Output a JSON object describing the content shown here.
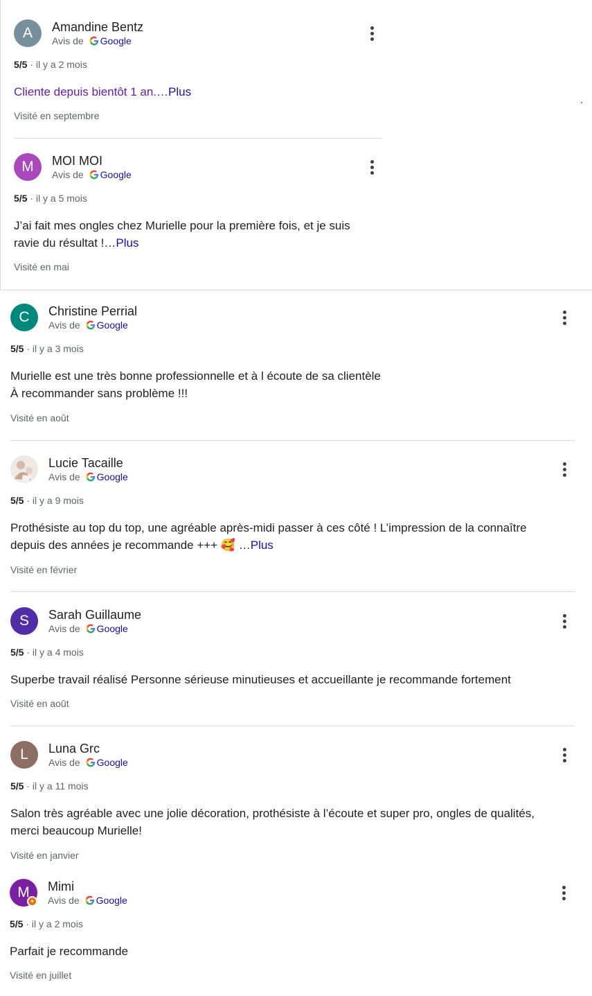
{
  "common": {
    "source_prefix": "Avis de",
    "source_name": "Google",
    "more_label": "Plus"
  },
  "reviews": [
    {
      "initial": "A",
      "name": "Amandine Bentz",
      "rating": "5/5",
      "time": "· il y a 2 mois",
      "text": "Cliente depuis bientôt 1 an.…",
      "more": "Plus",
      "visited": "Visité en septembre",
      "avatar_color": "#78909c"
    },
    {
      "initial": "M",
      "name": "MOI MOI",
      "rating": "5/5",
      "time": "· il y a 5 mois",
      "text": "J’ai fait mes ongles chez Murielle pour la première fois, et je suis ravie du résultat !…",
      "more": "Plus",
      "visited": "Visité en mai",
      "avatar_color": "#ab47bc"
    },
    {
      "initial": "C",
      "name": "Christine Perrial",
      "rating": "5/5",
      "time": "· il y a 3 mois",
      "text_line1": "Murielle est une très bonne professionnelle et à l écoute de sa clientèle",
      "text_line2": "À recommander sans problème !!!",
      "visited": "Visité en août",
      "avatar_color": "#00897b"
    },
    {
      "initial": "",
      "name": "Lucie Tacaille",
      "rating": "5/5",
      "time": "· il y a 9 mois",
      "text": "Prothésiste au top du top, une agréable après-midi passer à ces côté ! L’impression de la connaître depuis des années je recommande +++ 🥰 …",
      "more": "Plus",
      "visited": "Visité en février",
      "avatar_icon": "photo-avatar-icon"
    },
    {
      "initial": "S",
      "name": "Sarah Guillaume",
      "rating": "5/5",
      "time": "· il y a 4 mois",
      "text": "Superbe travail réalisé Personne sérieuse minutieuses et accueillante je recommande fortement",
      "visited": "Visité en août",
      "avatar_color": "#512da8"
    },
    {
      "initial": "L",
      "name": "Luna Grc",
      "rating": "5/5",
      "time": "· il y a 11 mois",
      "text": "Salon très agréable avec une jolie décoration, prothésiste à l’écoute et super pro, ongles de qualités, merci beaucoup Murielle!",
      "visited": "Visité en janvier",
      "avatar_color": "#8d6e63"
    },
    {
      "initial": "M",
      "name": "Mimi",
      "rating": "5/5",
      "time": "· il y a 2 mois",
      "text": "Parfait je recommande",
      "visited": "Visité en juillet",
      "avatar_color": "#7b1fa2",
      "badge_icon": "local-guide-badge-icon"
    }
  ]
}
